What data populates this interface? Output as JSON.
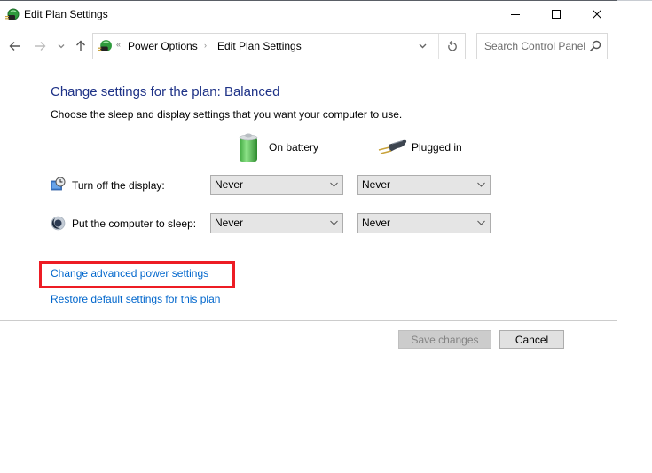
{
  "window": {
    "title": "Edit Plan Settings",
    "controls": {
      "minimize": "minimize",
      "maximize": "maximize",
      "close": "close"
    }
  },
  "nav": {
    "back_icon": "arrow-left-icon",
    "forward_icon": "arrow-right-icon",
    "recent_icon": "chevron-down-icon",
    "up_icon": "arrow-up-icon",
    "address": {
      "overflow": "«",
      "breadcrumbs": [
        "Power Options",
        "Edit Plan Settings"
      ],
      "separator": "›"
    },
    "search": {
      "placeholder": "Search Control Panel",
      "value": ""
    }
  },
  "content": {
    "heading": "Change settings for the plan: Balanced",
    "subheading": "Choose the sleep and display settings that you want your computer to use.",
    "columns": {
      "battery": "On battery",
      "plugged": "Plugged in"
    },
    "rows": [
      {
        "label": "Turn off the display:",
        "battery": "Never",
        "plugged": "Never",
        "icon": "display-timer-icon"
      },
      {
        "label": "Put the computer to sleep:",
        "battery": "Never",
        "plugged": "Never",
        "icon": "sleep-moon-icon"
      }
    ],
    "links": {
      "advanced": "Change advanced power settings",
      "restore": "Restore default settings for this plan"
    },
    "highlight_color": "#ed1c24"
  },
  "footer": {
    "save_label": "Save changes",
    "save_enabled": false,
    "cancel_label": "Cancel"
  },
  "colors": {
    "heading": "#1e3287",
    "link": "#0066cc"
  }
}
